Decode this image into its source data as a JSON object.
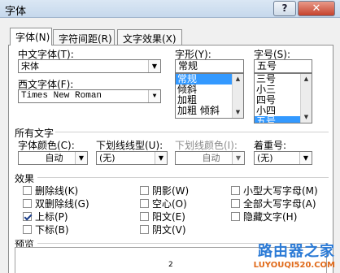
{
  "window": {
    "title": "字体",
    "help": "?",
    "close": "✕"
  },
  "tabs": [
    {
      "label": "字体(N)"
    },
    {
      "label": "字符间距(R)"
    },
    {
      "label": "文字效果(X)"
    }
  ],
  "fonts": {
    "chinese_label": "中文字体(T):",
    "chinese_value": "宋体",
    "western_label": "西文字体(F):",
    "western_value": "Times New Roman"
  },
  "style": {
    "label": "字形(Y):",
    "value": "常规",
    "items": [
      "常规",
      "倾斜",
      "加粗",
      "加粗 倾斜"
    ],
    "selected_index": 0
  },
  "size": {
    "label": "字号(S):",
    "value": "五号",
    "items": [
      "三号",
      "小三",
      "四号",
      "小四",
      "五号"
    ],
    "selected_index": 4
  },
  "all_text": {
    "heading": "所有文字",
    "color_label": "字体颜色(C):",
    "color_value": "自动",
    "underline_label": "下划线线型(U):",
    "underline_value": "(无)",
    "underline_color_label": "下划线颜色(I):",
    "underline_color_value": "自动",
    "emphasis_label": "着重号:",
    "emphasis_value": "(无)"
  },
  "effects": {
    "heading": "效果",
    "items": [
      {
        "label": "删除线(K)",
        "checked": false
      },
      {
        "label": "双删除线(G)",
        "checked": false
      },
      {
        "label": "上标(P)",
        "checked": true
      },
      {
        "label": "下标(B)",
        "checked": false
      },
      {
        "label": "阴影(W)",
        "checked": false
      },
      {
        "label": "空心(O)",
        "checked": false
      },
      {
        "label": "阳文(E)",
        "checked": false
      },
      {
        "label": "阴文(V)",
        "checked": false
      },
      {
        "label": "小型大写字母(M)",
        "checked": false
      },
      {
        "label": "全部大写字母(A)",
        "checked": false
      },
      {
        "label": "隐藏文字(H)",
        "checked": false
      }
    ]
  },
  "preview": {
    "heading": "预览",
    "sample": "2"
  },
  "watermark": {
    "brand": "路由器之家",
    "url": "LUYOUQI520.COM"
  }
}
